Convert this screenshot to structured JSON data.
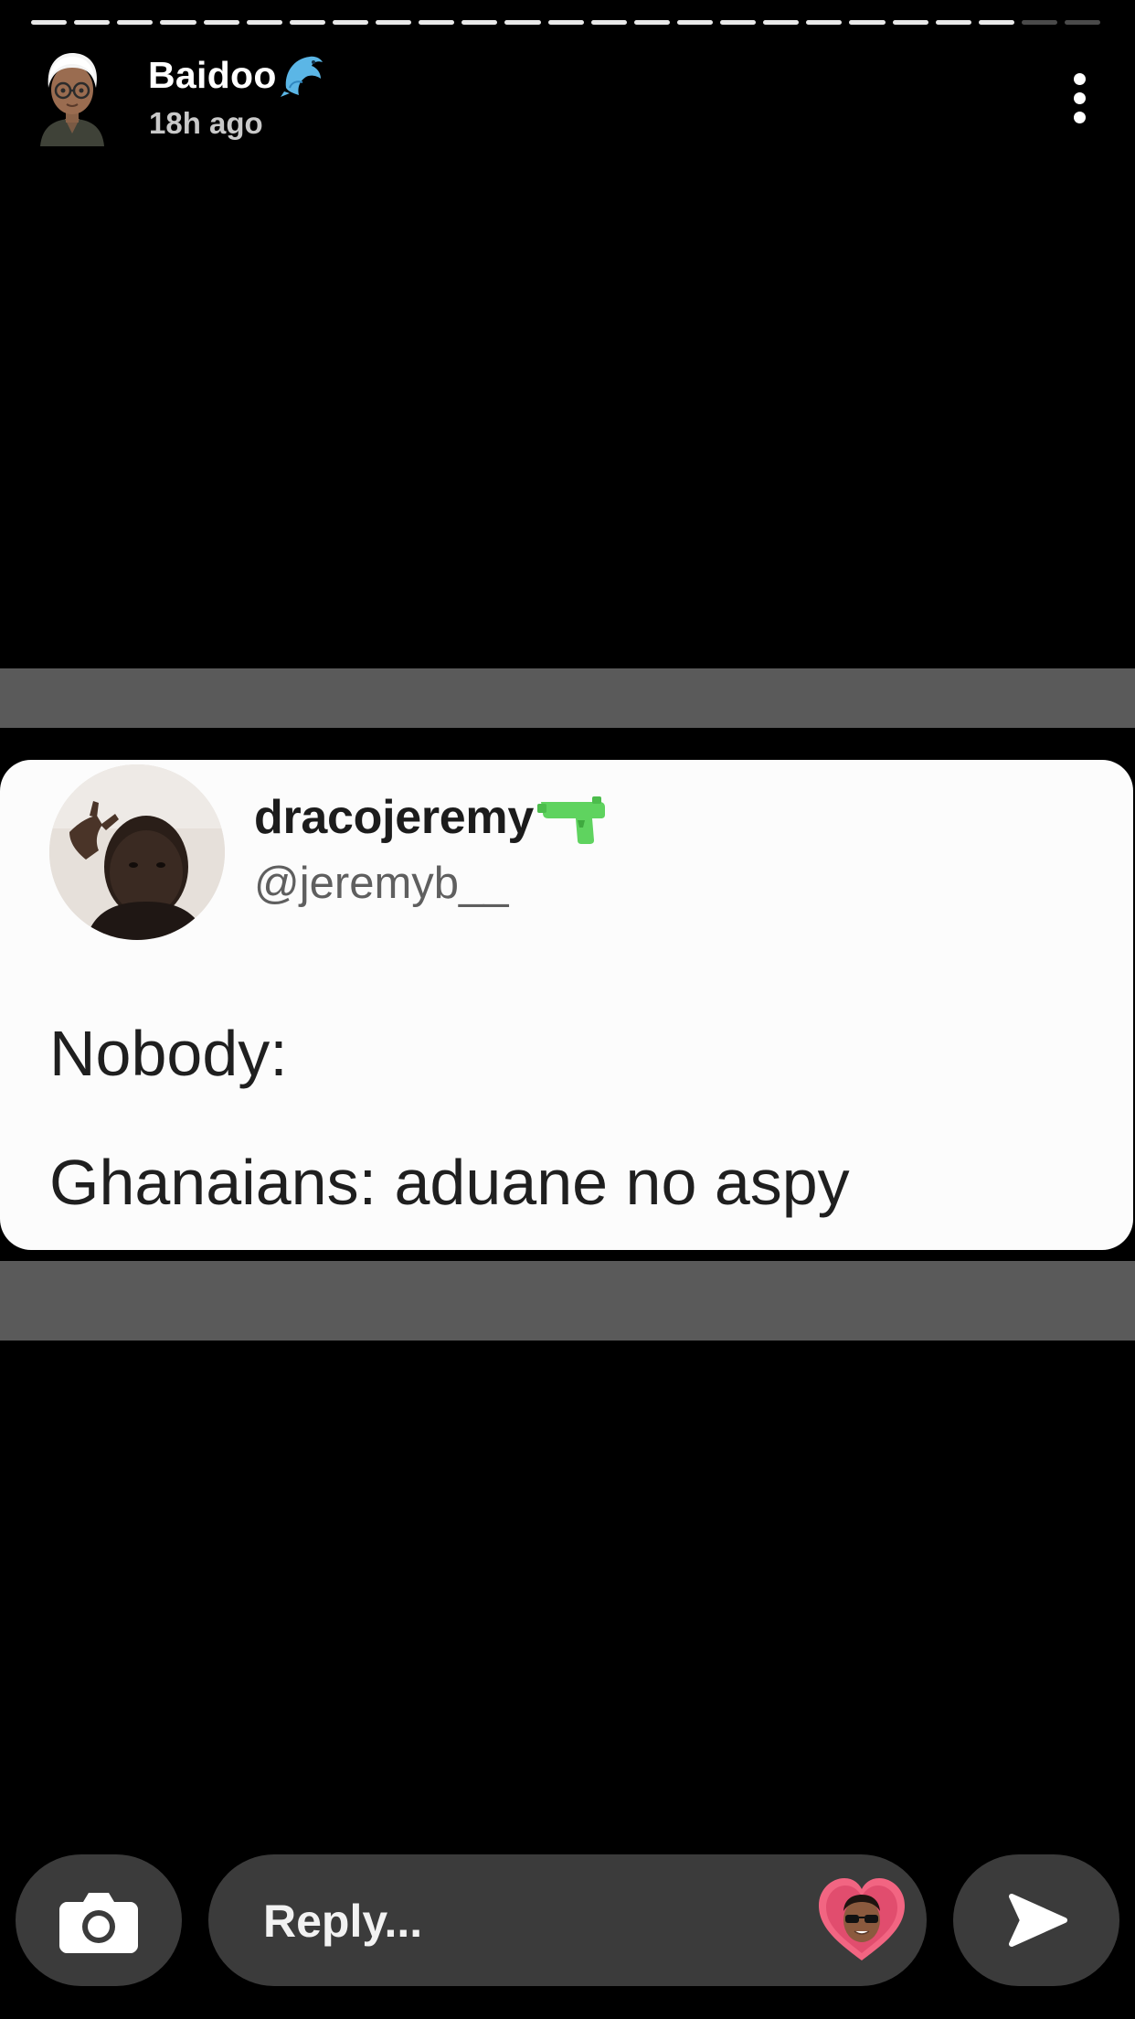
{
  "story": {
    "progress_segments_total": 25,
    "progress_segments_viewed": 23
  },
  "header": {
    "user_name": "Baidoo",
    "user_emoji_icon": "dolphin-icon",
    "time_ago": "18h ago",
    "more_icon": "more-vertical-icon"
  },
  "tweet": {
    "display_name": "dracojeremy",
    "display_name_emoji_icon": "water-pistol-icon",
    "handle": "@jeremyb__",
    "line1": "Nobody:",
    "line2": "Ghanaians: aduane no aspy"
  },
  "footer": {
    "camera_icon": "camera-icon",
    "reply_placeholder": "Reply...",
    "reaction_icon": "heart-bitmoji-icon",
    "send_icon": "send-arrow-icon"
  },
  "colors": {
    "background": "#000000",
    "pill": "#3b3b3b",
    "band": "#5a5a5a",
    "card": "#fcfcfc",
    "accent_gun": "#5fd35f",
    "heart": "#f26582"
  }
}
